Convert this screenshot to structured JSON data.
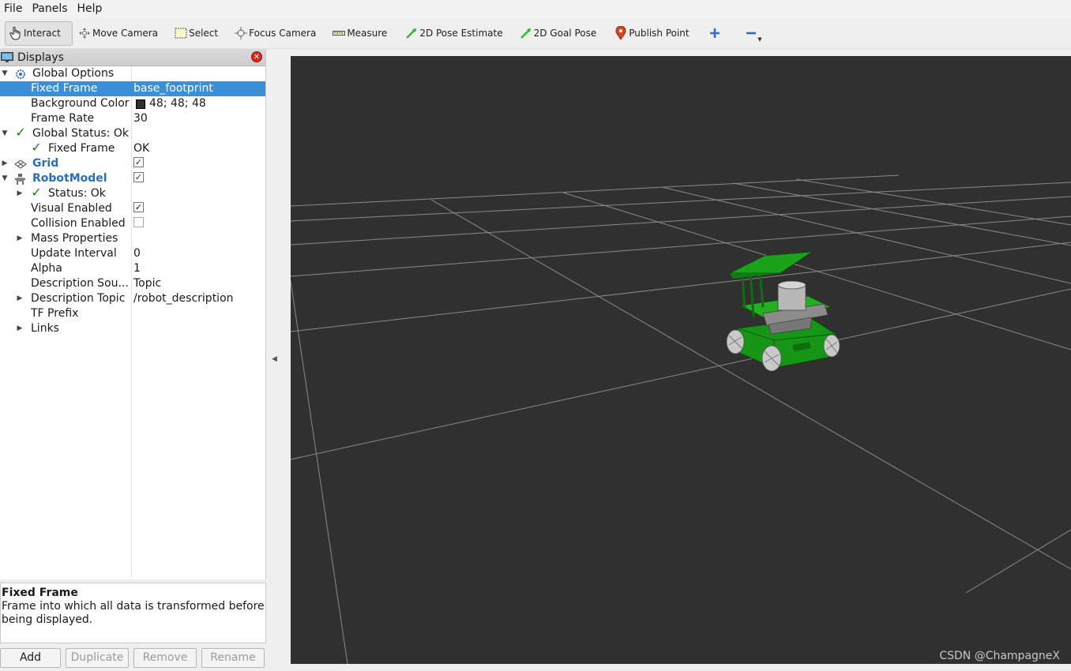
{
  "menu": [
    "File",
    "Panels",
    "Help"
  ],
  "toolbar": {
    "interact": "Interact",
    "move_camera": "Move Camera",
    "select": "Select",
    "focus_camera": "Focus Camera",
    "measure": "Measure",
    "pose_estimate": "2D Pose Estimate",
    "goal_pose": "2D Goal Pose",
    "publish_point": "Publish Point"
  },
  "displays": {
    "title": "Displays",
    "rows": [
      {
        "name": "Global Options",
        "value": ""
      },
      {
        "name": "Fixed Frame",
        "value": "base_footprint"
      },
      {
        "name": "Background Color",
        "value": "48; 48; 48"
      },
      {
        "name": "Frame Rate",
        "value": "30"
      },
      {
        "name": "Global Status: Ok",
        "value": ""
      },
      {
        "name": "Fixed Frame",
        "value": "OK"
      },
      {
        "name": "Grid",
        "value": ""
      },
      {
        "name": "RobotModel",
        "value": ""
      },
      {
        "name": "Status: Ok",
        "value": ""
      },
      {
        "name": "Visual Enabled",
        "value": ""
      },
      {
        "name": "Collision Enabled",
        "value": ""
      },
      {
        "name": "Mass Properties",
        "value": ""
      },
      {
        "name": "Update Interval",
        "value": "0"
      },
      {
        "name": "Alpha",
        "value": "1"
      },
      {
        "name": "Description Sou...",
        "value": "Topic"
      },
      {
        "name": "Description Topic",
        "value": "/robot_description"
      },
      {
        "name": "TF Prefix",
        "value": ""
      },
      {
        "name": "Links",
        "value": ""
      }
    ]
  },
  "description": {
    "title": "Fixed Frame",
    "text": "Frame into which all data is transformed before being displayed."
  },
  "buttons": {
    "add": "Add",
    "duplicate": "Duplicate",
    "remove": "Remove",
    "rename": "Rename"
  },
  "viewport": {
    "background_color": "#303030",
    "watermark": "CSDN @ChampagneX"
  },
  "colors": {
    "selection": "#3b8fd6",
    "link": "#2a6fb5",
    "robot_green": "#1fa51f"
  }
}
